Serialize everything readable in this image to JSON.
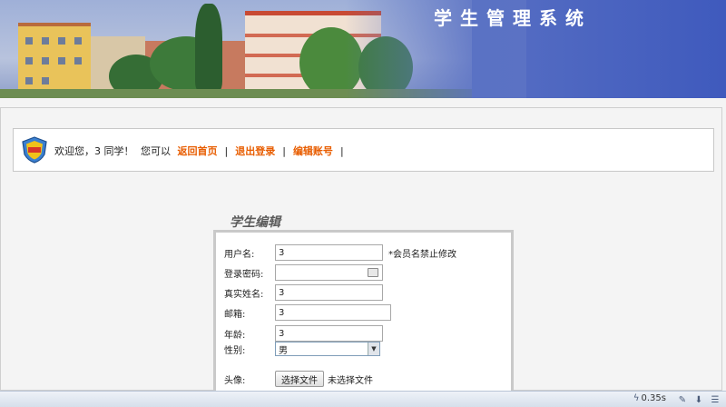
{
  "header": {
    "title": "学生管理系统"
  },
  "welcome": {
    "greeting": "欢迎您，3 同学！",
    "can_text": "您可以",
    "links": [
      "返回首页",
      "退出登录",
      "编辑账号"
    ],
    "separator": "|"
  },
  "form": {
    "title": "学生编辑",
    "fields": {
      "username": {
        "label": "用户名:",
        "value": "3",
        "note": "*会员名禁止修改"
      },
      "password": {
        "label": "登录密码:",
        "value": ""
      },
      "realname": {
        "label": "真实姓名:",
        "value": "3"
      },
      "email": {
        "label": "邮箱:",
        "value": "3"
      },
      "age": {
        "label": "年龄:",
        "value": "3"
      },
      "gender": {
        "label": "性别:",
        "value": "男"
      },
      "avatar": {
        "label": "头像:",
        "button": "选择文件",
        "status": "未选择文件"
      }
    }
  },
  "statusbar": {
    "timing": "0.35s"
  },
  "colors": {
    "link": "#e85d00",
    "banner": "#5b72c4"
  }
}
